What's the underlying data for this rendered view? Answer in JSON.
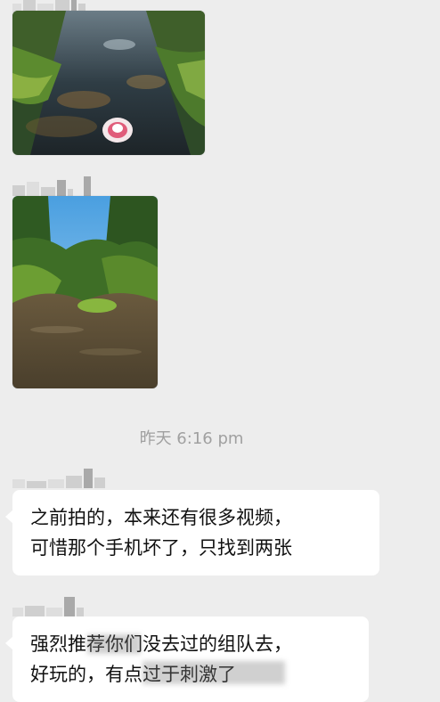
{
  "chat": {
    "messages": [
      {
        "kind": "image",
        "subject": "river-with-inflatable-boat"
      },
      {
        "kind": "image",
        "subject": "river-in-forest"
      },
      {
        "kind": "timestamp",
        "text": "昨天 6:16 pm"
      },
      {
        "kind": "text",
        "lines": [
          "之前拍的，本来还有很多视频，",
          "可惜那个手机坏了，只找到两张"
        ]
      },
      {
        "kind": "text",
        "lines": [
          "强烈推荐你们没去过的组队去，",
          "好玩的，有点过于刺激了"
        ]
      }
    ]
  }
}
